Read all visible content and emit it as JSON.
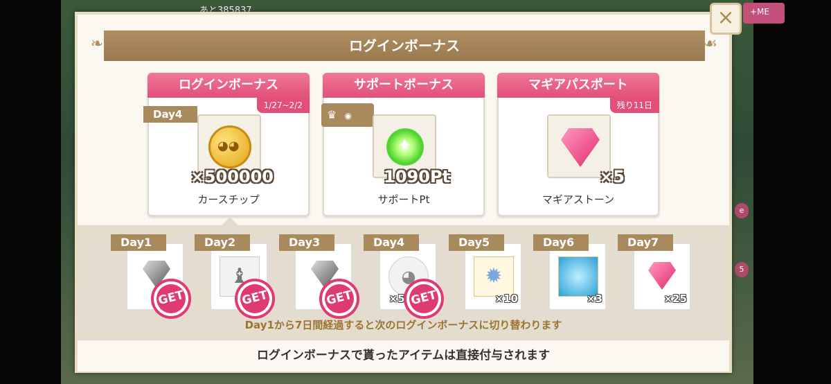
{
  "hud": {
    "counter_text": "あと385837",
    "right_tab_label": "+ME"
  },
  "dialog": {
    "title": "ログインボーナス",
    "close_label": "×"
  },
  "cards": [
    {
      "header": "ログインボーナス",
      "sub_tag": "1/27~2/2",
      "day_tag": "Day4",
      "quantity": "×500000",
      "name": "カースチップ",
      "icon": "coin-icon"
    },
    {
      "header": "サポートボーナス",
      "quantity": "1090Pt",
      "name": "サポートPt",
      "icon": "support-orb-icon"
    },
    {
      "header": "マギアパスポート",
      "sub_tag": "残り11日",
      "quantity": "×5",
      "name": "マギアストーン",
      "icon": "magia-stone-icon"
    }
  ],
  "days": [
    {
      "label": "Day1",
      "icon": "gray-gem-icon",
      "quantity": "",
      "obtained": true
    },
    {
      "label": "Day2",
      "icon": "figure-icon",
      "quantity": "",
      "obtained": true
    },
    {
      "label": "Day3",
      "icon": "gray-gem-icon",
      "quantity": "",
      "obtained": true
    },
    {
      "label": "Day4",
      "icon": "coin-icon",
      "quantity": "×50",
      "obtained": true
    },
    {
      "label": "Day5",
      "icon": "crystal-icon",
      "quantity": "×10",
      "obtained": false
    },
    {
      "label": "Day6",
      "icon": "stained-glass-icon",
      "quantity": "×3",
      "obtained": false
    },
    {
      "label": "Day7",
      "icon": "pink-gem-icon",
      "quantity": "×25",
      "obtained": false
    }
  ],
  "get_badge": "GET",
  "notice": "Day1から7日間経過すると次のログインボーナスに切り替わります",
  "footer": "ログインボーナスで貰ったアイテムは直接付与されます",
  "side_chips": [
    "e",
    "5"
  ]
}
